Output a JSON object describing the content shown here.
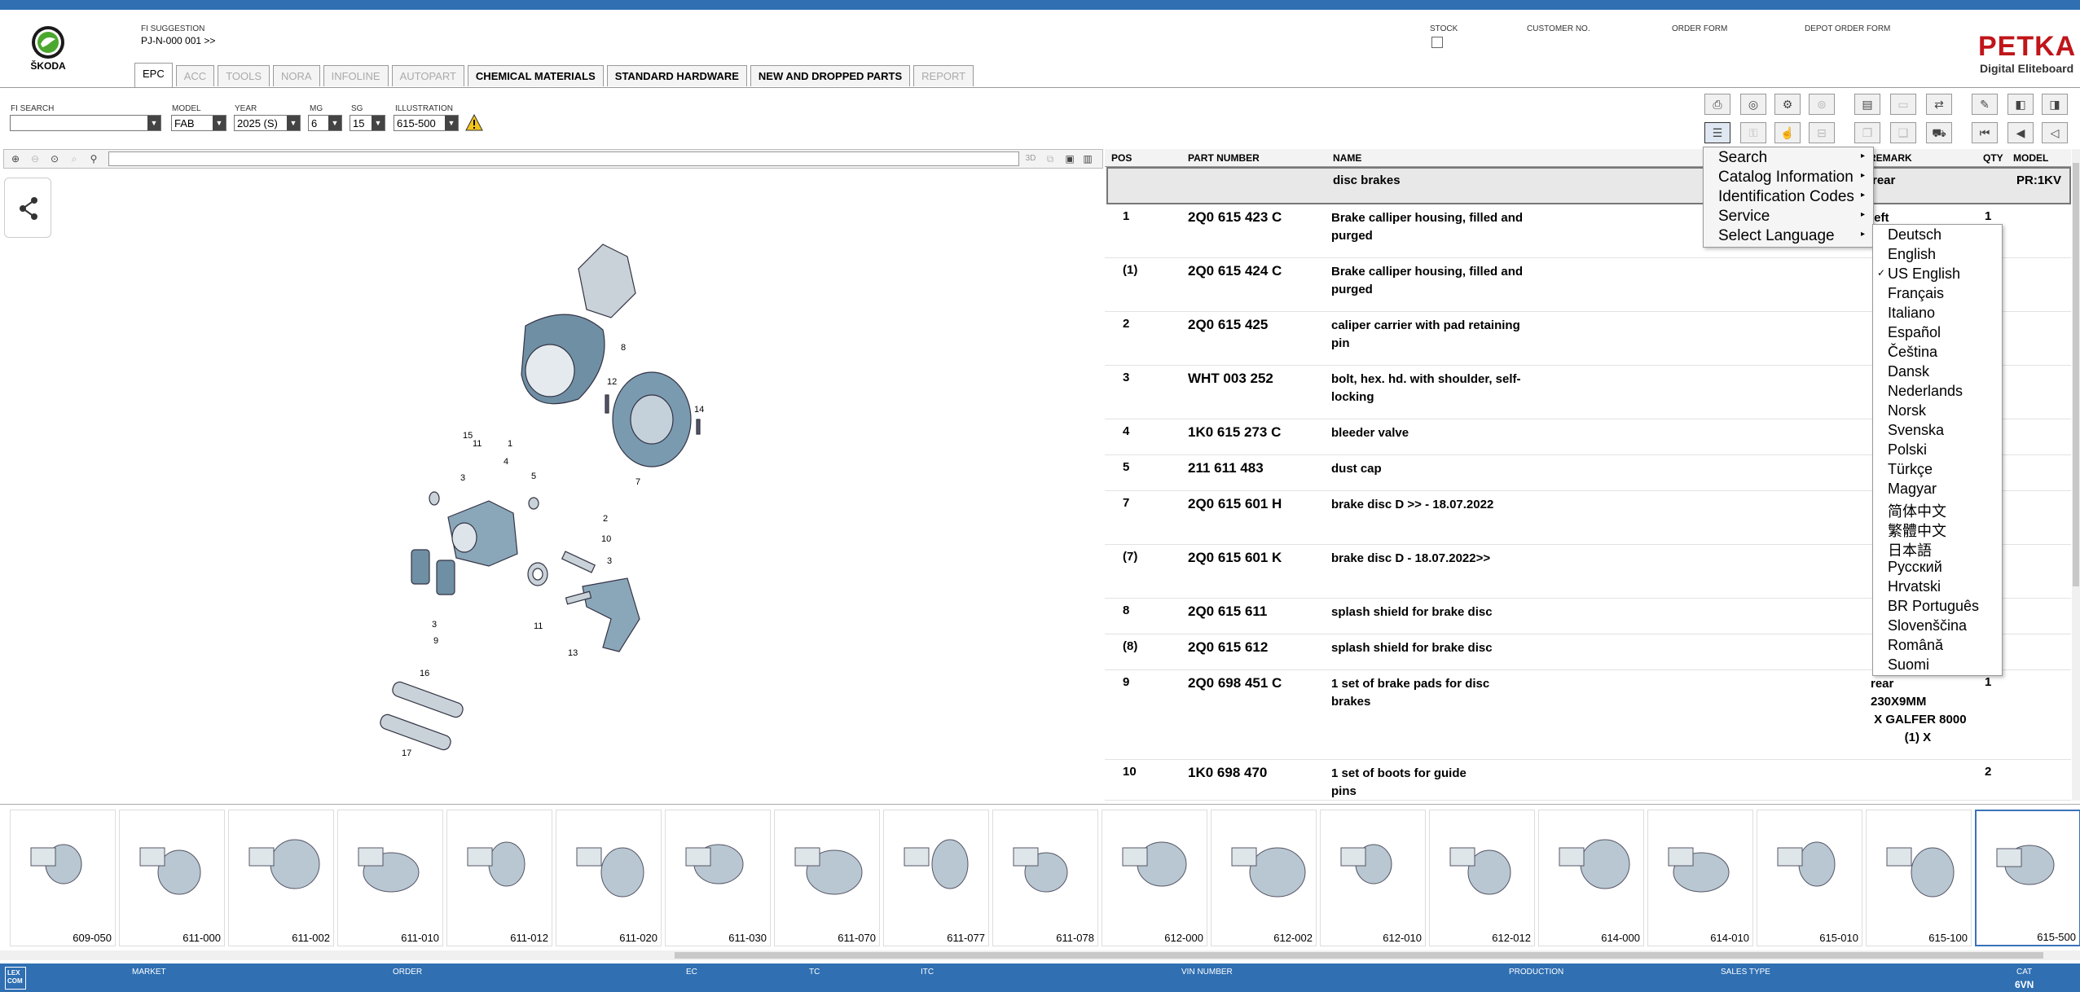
{
  "brand": {
    "name": "ŠKODA",
    "app_name": "PETKA",
    "app_sub": "Digital Eliteboard"
  },
  "header": {
    "fi_suggestion_label": "FI SUGGESTION",
    "fi_suggestion_value": "PJ-N-000 001 >>",
    "stock_label": "STOCK",
    "customer_label": "CUSTOMER NO.",
    "order_form_label": "ORDER FORM",
    "depot_order_label": "DEPOT ORDER FORM"
  },
  "tabs": [
    {
      "label": "EPC",
      "state": "active"
    },
    {
      "label": "ACC",
      "state": "disabled"
    },
    {
      "label": "TOOLS",
      "state": "disabled"
    },
    {
      "label": "NORA",
      "state": "disabled"
    },
    {
      "label": "INFOLINE",
      "state": "disabled"
    },
    {
      "label": "AUTOPART",
      "state": "disabled"
    },
    {
      "label": "CHEMICAL MATERIALS",
      "state": "normal"
    },
    {
      "label": "STANDARD HARDWARE",
      "state": "normal"
    },
    {
      "label": "NEW AND DROPPED PARTS",
      "state": "normal"
    },
    {
      "label": "REPORT",
      "state": "disabled"
    }
  ],
  "filters": {
    "fi_search_label": "FI SEARCH",
    "fi_search_value": "",
    "model_label": "MODEL",
    "model_value": "FAB",
    "year_label": "YEAR",
    "year_value": "2025 (S)",
    "mg_label": "MG",
    "mg_value": "6",
    "sg_label": "SG",
    "sg_value": "15",
    "illustration_label": "ILLUSTRATION",
    "illustration_value": "615-500"
  },
  "table": {
    "columns": {
      "pos": "POS",
      "part": "PART NUMBER",
      "name": "NAME",
      "remark": "REMARK",
      "qty": "QTY",
      "model": "MODEL"
    },
    "group": {
      "name": "disc brakes",
      "remark": "rear",
      "model": "PR:1KV"
    },
    "rows": [
      {
        "pos": "1",
        "part": "2Q0 615 423 C",
        "name": "Brake calliper housing, filled and purged",
        "remark": "left",
        "qty": "1"
      },
      {
        "pos": "(1)",
        "part": "2Q0 615 424 C",
        "name": "Brake calliper housing, filled and purged",
        "remark": "",
        "qty": ""
      },
      {
        "pos": "2",
        "part": "2Q0 615 425",
        "name": "caliper carrier with pad retaining pin",
        "remark": "",
        "qty": ""
      },
      {
        "pos": "3",
        "part": "WHT 003 252",
        "name": "bolt, hex. hd. with shoulder, self-locking",
        "remark": "",
        "qty": ""
      },
      {
        "pos": "4",
        "part": "1K0 615 273 C",
        "name": "bleeder valve",
        "remark": "",
        "qty": ""
      },
      {
        "pos": "5",
        "part": "211 611 483",
        "name": "dust cap",
        "remark": "",
        "qty": ""
      },
      {
        "pos": "7",
        "part": "2Q0 615 601 H",
        "name": "brake disc D >> - 18.07.2022",
        "remark": "",
        "qty": ""
      },
      {
        "pos": "(7)",
        "part": "2Q0 615 601 K",
        "name": "brake disc D - 18.07.2022>>",
        "remark": "",
        "qty": ""
      },
      {
        "pos": "8",
        "part": "2Q0 615 611",
        "name": "splash shield for brake disc",
        "remark": "",
        "qty": ""
      },
      {
        "pos": "(8)",
        "part": "2Q0 615 612",
        "name": "splash shield for brake disc",
        "remark": "",
        "qty": ""
      },
      {
        "pos": "9",
        "part": "2Q0 698 451 C",
        "name": "1 set of brake pads for disc brakes",
        "remark": "rear\n230X9MM\n X GALFER 8000\n          (1) X",
        "qty": "1"
      },
      {
        "pos": "10",
        "part": "1K0 698 470",
        "name": "1 set of boots for guide pins",
        "remark": "",
        "qty": "2"
      }
    ]
  },
  "context_menu": {
    "items": [
      "Search",
      "Catalog Information",
      "Identification Codes",
      "Service",
      "Select Language"
    ]
  },
  "languages": {
    "selected": "US English",
    "items": [
      "Deutsch",
      "English",
      "US English",
      "Français",
      "Italiano",
      "Español",
      "Čeština",
      "Dansk",
      "Nederlands",
      "Norsk",
      "Svenska",
      "Polski",
      "Türkçe",
      "Magyar",
      "简体中文",
      "繁體中文",
      "日本語",
      "Русский",
      "Hrvatski",
      "BR Português",
      "Slovenščina",
      "Română",
      "Suomi"
    ]
  },
  "thumbnails": [
    "609-050",
    "611-000",
    "611-002",
    "611-010",
    "611-012",
    "611-020",
    "611-030",
    "611-070",
    "611-077",
    "611-078",
    "612-000",
    "612-002",
    "612-010",
    "612-012",
    "614-000",
    "614-010",
    "615-010",
    "615-100",
    "615-500"
  ],
  "thumbnail_selected": "615-500",
  "status": {
    "lexcom": "LEX COM",
    "market": "MARKET",
    "order": "ORDER",
    "ec": "EC",
    "tc": "TC",
    "itc": "ITC",
    "vin": "VIN NUMBER",
    "production": "PRODUCTION",
    "sales_type": "SALES TYPE",
    "cat": "CAT",
    "cat_value": "6VN"
  },
  "colors": {
    "accent": "#2f6fb2",
    "petka_red": "#c0151a",
    "skoda_green": "#4ba82e"
  }
}
